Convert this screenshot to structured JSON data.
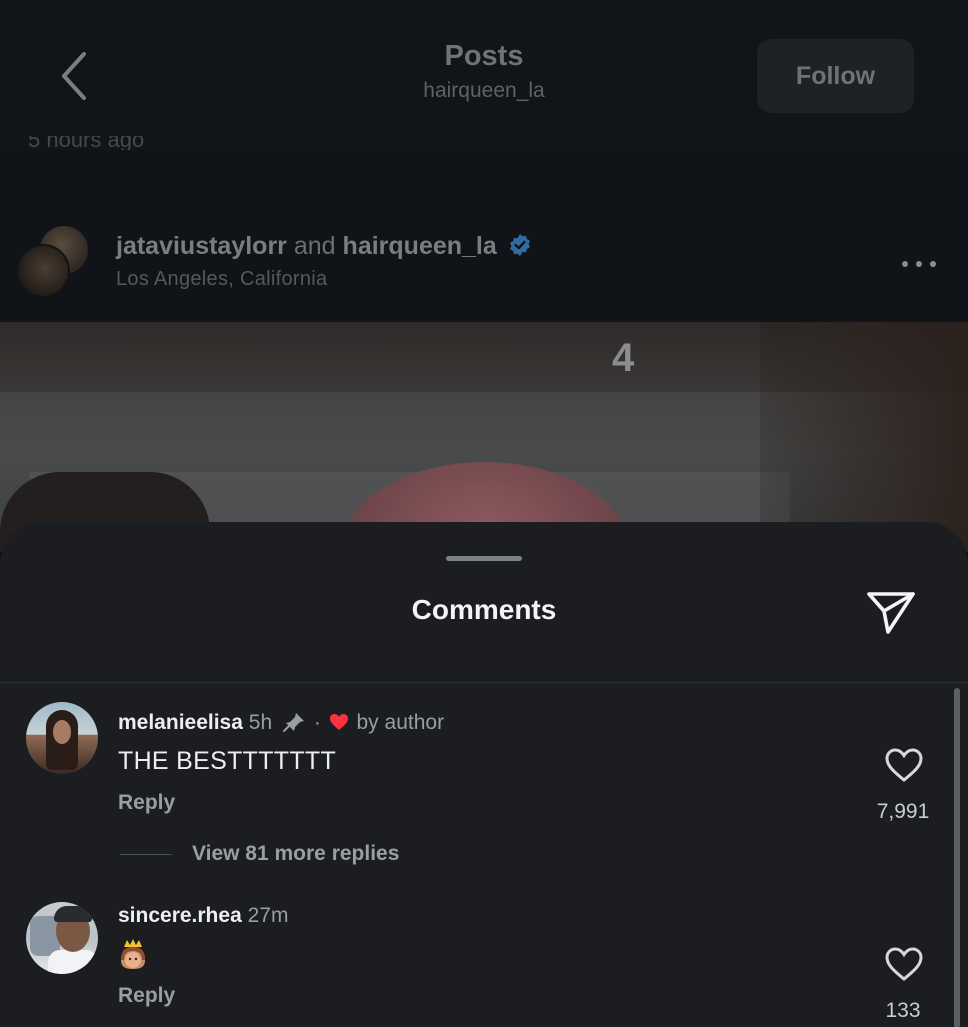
{
  "header": {
    "title": "Posts",
    "subtitle": "hairqueen_la",
    "follow_label": "Follow",
    "time_ago": "5 hours ago"
  },
  "post": {
    "user1": "jataviustaylorr",
    "connector": "and",
    "user2": "hairqueen_la",
    "location": "Los Angeles, California",
    "jersey_number": "4"
  },
  "comments_sheet": {
    "title": "Comments",
    "comments": [
      {
        "username": "melanieelisa",
        "time": "5h",
        "separator": "·",
        "liked_by": "by author",
        "text": "THE BESTTTTTTT",
        "reply_label": "Reply",
        "likes": "7,991",
        "view_replies": "View 81 more replies"
      },
      {
        "username": "sincere.rhea",
        "time": "27m",
        "emoji": "princess-emoji",
        "reply_label": "Reply",
        "likes": "133"
      }
    ]
  },
  "colors": {
    "background": "#0d0f12",
    "sheet": "#1b1d21",
    "verified": "#3b82c4",
    "liked_heart": "#ff3040"
  }
}
